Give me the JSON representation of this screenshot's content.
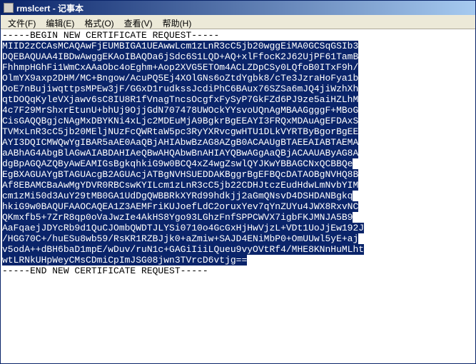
{
  "titlebar": {
    "text": "rmslcert - 记事本"
  },
  "menubar": {
    "file": "文件(F)",
    "edit": "编辑(E)",
    "format": "格式(O)",
    "view": "查看(V)",
    "help": "帮助(H)"
  },
  "content": {
    "begin": "-----BEGIN NEW CERTIFICATE REQUEST-----",
    "lines": [
      "MIID2zCCAsMCAQAwFjEUMBIGA1UEAwwLcm1zLnR3cC5jb20wggEiMA0GCSqGSIb3",
      "DQEBAQUAA4IBDwAwggEKAoIBAQDa6jSdc6S1LQD+AQ+xlFfocK2J62UjPF61TamB",
      "FhhmpHGhFi1WmCxAAaObc4oEghm+Aop2XVG5ETOm4ACLZDpCSy0LQfoB0ITxF9h/",
      "OlmYX9axp2DHM/MC+Bngow/AcuPQ5Ej4XOlGNs6oZtdYgbk8/cTe3JzraHoFya1b",
      "OoE7nBujiwqttpsMPEw3jF/GGxD1rudkssJcdiPhC6BAux76SZSa6mJQ4jiWzhXh",
      "qtDOQqKyleVXjawv6sC8IU8R1fVnagTncsOcgfxFySyP7GkFZd6PJ9ze5aiHZLhM",
      "4c7F29MrShxrEtunU+bhUj9OjjGdN707478UWOckYYsvoUQnAgMBAAGgggF+MBoG",
      "CisGAQQBgjcNAgMxDBYKNi4xLjc2MDEuMjA9BgkrBgEEAYI3FRQxMDAuAgEFDAxS",
      "TVMxLnR3cC5jb20MEljNUzFcQWRtaW5pc3RyYXRvcgwHTU1DLkVYRTByBgorBgEE",
      "AYI3DQICMWQwYgIBAR5aAE0AaQBjAHIAbwBzAG8AZgB0ACAAUgBTAEEAIABTAEMA",
      "aABhAG4AbgBlAGwAIABDAHIAeQBwAHQAbwBnAHIAYQBwAGgAaQBjACAAUAByAG8A",
      "dgBpAGQAZQByAwEAMIGsBgkqhkiG9w0BCQ4xZ4wgZswlQYJKwYBBAGCNxQCBBQe",
      "EgBXAGUAYgBTAGUAcgB2AGUAcjATBgNVHSUEDDAKBggrBgEFBQcDATAOBgNVHQ8B",
      "Af8EBAMCBaAwMgYDVR0RBCswKYILcm1zLnR3cC5jb22CDHJtczEudHdwLmNvbYIM",
      "cm1zMi50d3AuY29tMB0GA1UdDgQWBBRkXYRd99hdkjj2aGmQNsvD4DSHDANBgkq",
      "hkiG9w0BAQUFAAOCAQEA1Z3AEMFriKUJoefLdC2oruxYev7qYnZUYu4JWX8RxvNC",
      "QKmxfb5+7ZrR8qp0oVaJwzIe4AkHS8Ygo93LGhzFnfSPPCWVX7igbFKJMNJA5B9",
      "AaFqaejJDYcRb9d1QuCJOmbQWDTJLYSi0710o4GcGxHjHwVjzL+VDt1UoJjEw192J",
      "/HGG70C+/huESu8wb59/RsKR1RZBJjk0+aZmiw+SAJD4ENiMbP0+OmUUwl5yE+aj",
      "v5odA++dBH6baD1mpE/wDuv/ruN1c+GAGiIiiLQueu9vyOVtRf4/MHE8KNnHuMLht"
    ],
    "last_selected": "wtLRNkUHpWeyCMsCDmiCpImJSG08jwn3TVrcD6vtjg==",
    "end": "-----END NEW CERTIFICATE REQUEST-----"
  }
}
